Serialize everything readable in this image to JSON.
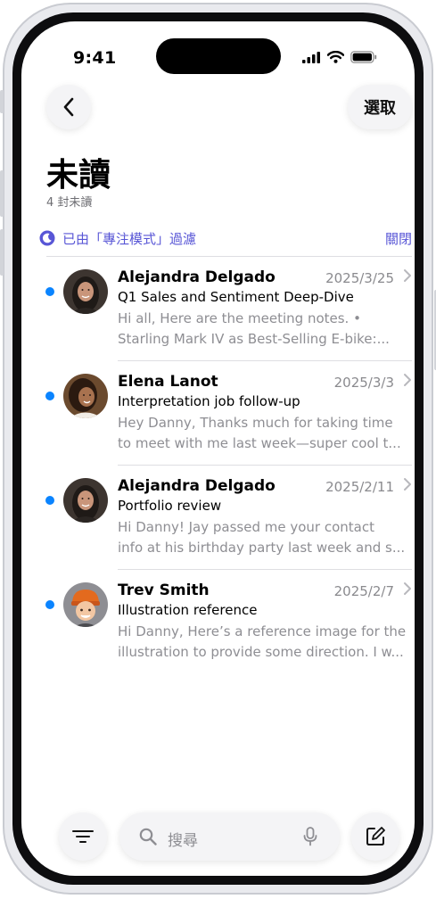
{
  "status_bar": {
    "time": "9:41"
  },
  "nav": {
    "select_label": "選取"
  },
  "mailbox": {
    "title": "未讀",
    "subtitle": "4 封未讀"
  },
  "focus_filter": {
    "text": "已由「專注模式」過濾",
    "close_label": "關閉",
    "accent_color": "#5856d6"
  },
  "messages": [
    {
      "sender": "Alejandra Delgado",
      "date": "2025/3/25",
      "subject": "Q1 Sales and Sentiment Deep-Dive",
      "preview_line1": "Hi all, Here are the meeting notes. •",
      "preview_line2": "Starling Mark IV as Best-Selling E-bike:..."
    },
    {
      "sender": "Elena Lanot",
      "date": "2025/3/3",
      "subject": "Interpretation job follow-up",
      "preview_line1": "Hey Danny, Thanks much for taking time",
      "preview_line2": "to meet with me last week—super cool t..."
    },
    {
      "sender": "Alejandra Delgado",
      "date": "2025/2/11",
      "subject": "Portfolio review",
      "preview_line1": "Hi Danny! Jay passed me your contact",
      "preview_line2": "info at his birthday party last week and s..."
    },
    {
      "sender": "Trev Smith",
      "date": "2025/2/7",
      "subject": "Illustration reference",
      "preview_line1": "Hi Danny, Here’s a reference image for the",
      "preview_line2": "illustration to provide some direction. I w..."
    }
  ],
  "bottom_bar": {
    "search_placeholder": "搜尋"
  },
  "colors": {
    "unread_dot": "#0a84ff",
    "secondary_text": "#8e8e93"
  }
}
